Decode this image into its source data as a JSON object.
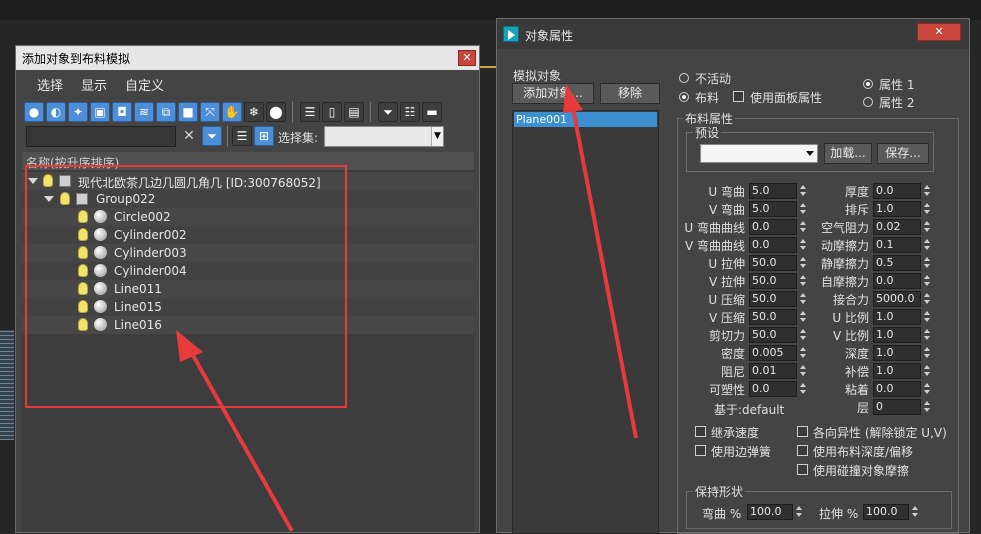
{
  "colors": {
    "accent_red": "#e63b3b",
    "selection_blue": "#3c8fd0"
  },
  "left_dialog": {
    "title": "添加对象到布料模拟",
    "menu": [
      "选择",
      "显示",
      "自定义"
    ],
    "selection_set_label": "选择集:",
    "column_header": "名称(按升序排序)",
    "tree": {
      "root": "现代北欧茶几边几圆几角几 [ID:300768052]",
      "group": "Group022",
      "items": [
        "Circle002",
        "Cylinder002",
        "Cylinder003",
        "Cylinder004",
        "Line011",
        "Line015",
        "Line016"
      ]
    }
  },
  "right_dialog": {
    "title": "对象属性",
    "sim_objects_label": "模拟对象",
    "add_button": "添加对象...",
    "remove_button": "移除",
    "object_list": [
      "Plane001"
    ],
    "radio_inactive": "不活动",
    "radio_cloth": "布料",
    "use_panel_props": "使用面板属性",
    "prop1": "属性 1",
    "prop2": "属性 2",
    "cloth_props_label": "布料属性",
    "preset_label": "预设",
    "load_button": "加载...",
    "save_button": "保存...",
    "left_params": [
      {
        "label": "U 弯曲",
        "value": "5.0"
      },
      {
        "label": "V 弯曲",
        "value": "5.0"
      },
      {
        "label": "U 弯曲曲线",
        "value": "0.0"
      },
      {
        "label": "V 弯曲曲线",
        "value": "0.0"
      },
      {
        "label": "U 拉伸",
        "value": "50.0"
      },
      {
        "label": "V 拉伸",
        "value": "50.0"
      },
      {
        "label": "U 压缩",
        "value": "50.0"
      },
      {
        "label": "V 压缩",
        "value": "50.0"
      },
      {
        "label": "剪切力",
        "value": "50.0"
      },
      {
        "label": "密度",
        "value": "0.005"
      },
      {
        "label": "阻尼",
        "value": "0.01"
      },
      {
        "label": "可塑性",
        "value": "0.0"
      }
    ],
    "based_on": "基于:default",
    "right_params": [
      {
        "label": "厚度",
        "value": "0.0"
      },
      {
        "label": "排斥",
        "value": "1.0"
      },
      {
        "label": "空气阻力",
        "value": "0.02"
      },
      {
        "label": "动摩擦力",
        "value": "0.1"
      },
      {
        "label": "静摩擦力",
        "value": "0.5"
      },
      {
        "label": "自摩擦力",
        "value": "0.0"
      },
      {
        "label": "接合力",
        "value": "5000.0"
      },
      {
        "label": "U 比例",
        "value": "1.0"
      },
      {
        "label": "V 比例",
        "value": "1.0"
      },
      {
        "label": "深度",
        "value": "1.0"
      },
      {
        "label": "补偿",
        "value": "1.0"
      },
      {
        "label": "粘着",
        "value": "0.0"
      },
      {
        "label": "层",
        "value": "0"
      }
    ],
    "checks_left": [
      "继承速度",
      "使用边弹簧"
    ],
    "checks_right": [
      "各向异性 (解除锁定 U,V)",
      "使用布料深度/偏移",
      "使用碰撞对象摩擦"
    ],
    "keep_shape_label": "保持形状",
    "bend_label": "弯曲 %",
    "bend_value": "100.0",
    "stretch_label": "拉伸 %",
    "stretch_value": "100.0"
  }
}
